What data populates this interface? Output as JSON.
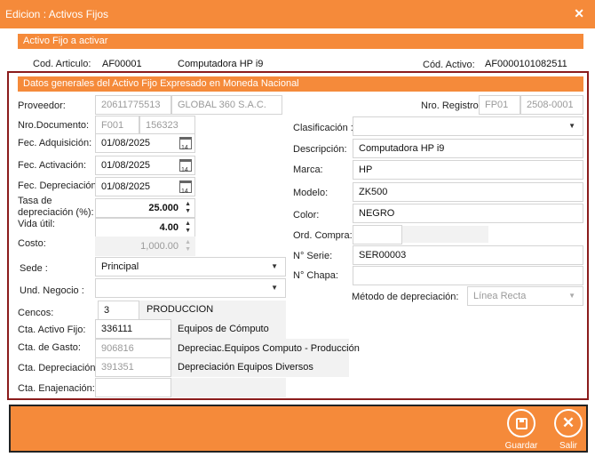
{
  "window": {
    "title": "Edicion : Activos Fijos",
    "close_glyph": "✕"
  },
  "section1": {
    "title": "Activo Fijo a activar",
    "cod_articulo_label": "Cod. Articulo:",
    "cod_articulo": "AF00001",
    "articulo_desc": "Computadora HP i9",
    "cod_activo_label": "Cód. Activo:",
    "cod_activo": "AF0000101082511"
  },
  "section2": {
    "title": "Datos generales del Activo Fijo Expresado en Moneda Nacional"
  },
  "left": {
    "proveedor_label": "Proveedor:",
    "proveedor_ruc": "20611775513",
    "proveedor_name": "GLOBAL 360 S.A.C.",
    "nro_doc_label": "Nro.Documento:",
    "doc_serie": "F001",
    "doc_num": "156323",
    "fec_adq_label": "Fec. Adquisición:",
    "fec_adq": "01/08/2025",
    "fec_act_label": "Fec. Activación:",
    "fec_act": "01/08/2025",
    "fec_dep_label": "Fec. Depreciación:",
    "fec_dep": "01/08/2025",
    "tasa_label_1": "Tasa de",
    "tasa_label_2": "depreciación (%):",
    "tasa": "25.000",
    "vida_label": "Vida útil:",
    "vida": "4.00",
    "costo_label": "Costo:",
    "costo": "1,000.00",
    "sede_label": "Sede :",
    "sede": "Principal",
    "und_label": "Und. Negocio :",
    "und": "",
    "cencos_label": "Cencos:",
    "cencos_code": "3",
    "cencos_name": "PRODUCCION",
    "cta_activo_label": "Cta. Activo Fijo:",
    "cta_activo": "336111",
    "cta_activo_desc": "Equipos de Cómputo",
    "cta_gasto_label": "Cta. de Gasto:",
    "cta_gasto": "906816",
    "cta_gasto_desc": "Depreciac.Equipos Computo - Producción",
    "cta_dep_label": "Cta. Depreciación :",
    "cta_dep": "391351",
    "cta_dep_desc": "Depreciación Equipos Diversos",
    "cta_enaj_label": "Cta. Enajenación:",
    "cta_enaj": ""
  },
  "right": {
    "nro_reg_label": "Nro. Registro:",
    "reg_serie": "FP01",
    "reg_num": "2508-0001",
    "clasif_label": "Clasificación :",
    "clasif": "",
    "desc_label": "Descripción:",
    "desc": "Computadora HP i9",
    "marca_label": "Marca:",
    "marca": "HP",
    "modelo_label": "Modelo:",
    "modelo": "ZK500",
    "color_label": "Color:",
    "color": "NEGRO",
    "ord_label": "Ord. Compra:",
    "ord": "",
    "serie_label": "N° Serie:",
    "serie": "SER00003",
    "chapa_label": "N° Chapa:",
    "chapa": "",
    "metodo_label": "Método de depreciación:",
    "metodo": "Línea Recta"
  },
  "actions": {
    "save": "Guardar",
    "exit": "Salir",
    "save_icon": "floppy-disk-icon",
    "exit_icon": "close-circle-icon"
  },
  "colors": {
    "accent": "#f58a3a",
    "frame": "#8b1c1c"
  }
}
